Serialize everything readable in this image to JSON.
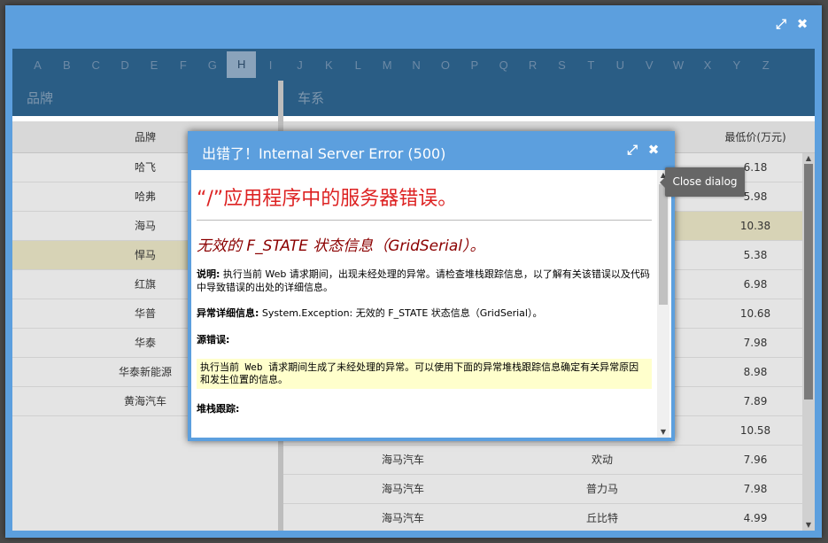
{
  "outer_window": {
    "maximize_icon": "maximize-icon",
    "close_icon": "close-icon"
  },
  "alphabet": [
    "A",
    "B",
    "C",
    "D",
    "E",
    "F",
    "G",
    "H",
    "I",
    "J",
    "K",
    "L",
    "M",
    "N",
    "O",
    "P",
    "Q",
    "R",
    "S",
    "T",
    "U",
    "V",
    "W",
    "X",
    "Y",
    "Z"
  ],
  "alphabet_active": "H",
  "brand_panel": {
    "title": "品牌",
    "column_header": "品牌",
    "items": [
      "哈飞",
      "哈弗",
      "海马",
      "悍马",
      "红旗",
      "华普",
      "华泰",
      "华泰新能源",
      "黄海汽车"
    ],
    "highlighted_index": 3
  },
  "series_panel": {
    "title": "车系",
    "column_min_price": "最低价(万元)",
    "prices": [
      "6.18",
      "5.98",
      "10.38",
      "5.38",
      "6.98",
      "10.68",
      "7.98",
      "8.98",
      "7.89",
      "10.58"
    ],
    "highlighted_index": 2,
    "rows": [
      {
        "brand": "海马汽车",
        "series": "欢动",
        "price": "7.96"
      },
      {
        "brand": "海马汽车",
        "series": "普力马",
        "price": "7.98"
      },
      {
        "brand": "海马汽车",
        "series": "丘比特",
        "price": "4.99"
      }
    ]
  },
  "dialog": {
    "title": "出错了！Internal Server Error (500)",
    "heading": "“/”应用程序中的服务器错误。",
    "subheading": "无效的 F_STATE 状态信息（GridSerial）。",
    "description_label": "说明:",
    "description_text": " 执行当前 Web 请求期间，出现未经处理的异常。请检查堆栈跟踪信息，以了解有关该错误以及代码中导致错误的出处的详细信息。",
    "exception_label": "异常详细信息:",
    "exception_text": " System.Exception: 无效的 F_STATE 状态信息（GridSerial）。",
    "source_label": "源错误:",
    "source_box": "执行当前 Web 请求期间生成了未经处理的异常。可以使用下面的异常堆栈跟踪信息确定有关异常原因和发生位置的信息。",
    "stack_label": "堆栈跟踪:"
  },
  "tooltip": {
    "text": "Close dialog"
  }
}
